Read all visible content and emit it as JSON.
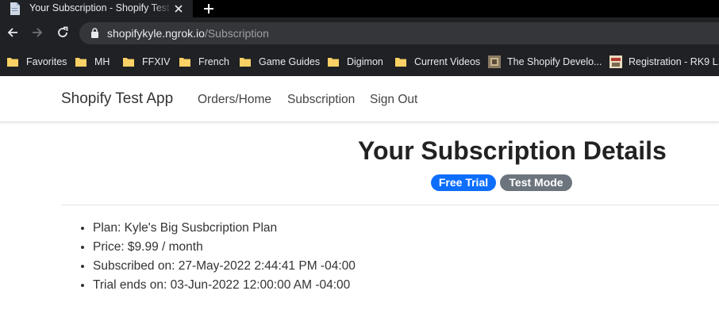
{
  "browser": {
    "tab": {
      "title": "Your Subscription - Shopify Test App",
      "favicon": "document-icon"
    },
    "url": {
      "host": "shopifykyle.ngrok.io",
      "path": "/Subscription"
    },
    "bookmarks": [
      {
        "label": "Favorites",
        "icon": "folder-icon"
      },
      {
        "label": "MH",
        "icon": "folder-icon"
      },
      {
        "label": "FFXIV",
        "icon": "folder-icon"
      },
      {
        "label": "French",
        "icon": "folder-icon"
      },
      {
        "label": "Game Guides",
        "icon": "folder-icon"
      },
      {
        "label": "Digimon",
        "icon": "folder-icon"
      },
      {
        "label": "Current Videos",
        "icon": "folder-icon"
      },
      {
        "label": "The Shopify Develo...",
        "icon": "site-favicon"
      },
      {
        "label": "Registration - RK9 L...",
        "icon": "site-favicon"
      }
    ]
  },
  "navbar": {
    "brand": "Shopify Test App",
    "links": [
      "Orders/Home",
      "Subscription",
      "Sign Out"
    ]
  },
  "main": {
    "title": "Your Subscription Details",
    "badges": [
      {
        "label": "Free Trial",
        "color": "#0d6efd"
      },
      {
        "label": "Test Mode",
        "color": "#6c757d"
      }
    ],
    "details": [
      "Plan: Kyle's Big Susbcription Plan",
      "Price: $9.99 / month",
      "Subscribed on: 27-May-2022 2:44:41 PM -04:00",
      "Trial ends on: 03-Jun-2022 12:00:00 AM -04:00"
    ]
  },
  "colors": {
    "folder": "#f9d165",
    "chrome_dark": "#202124"
  }
}
